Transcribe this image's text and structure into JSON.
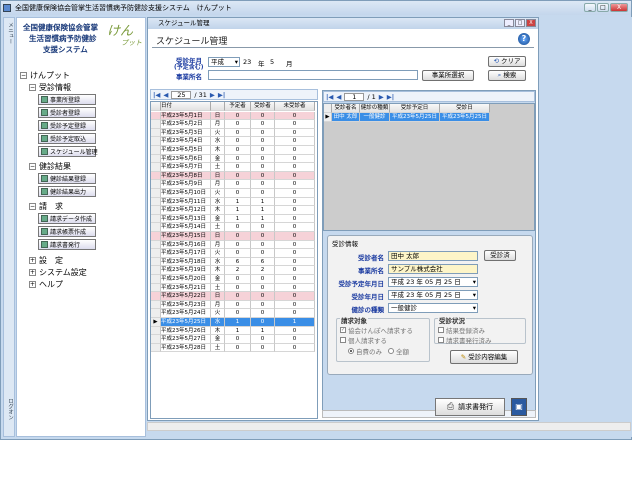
{
  "window": {
    "title": "全国健康保険協会管掌生活習慣病予防健診支援システム　けんプット",
    "minimize": "_",
    "maximize": "□",
    "close": "X"
  },
  "left_strip": {
    "top_label": "メニュー",
    "bottom_label": "ログオン"
  },
  "logo": {
    "line1": "全国健康保険協会管掌",
    "line2": "生活習慣病予防健診",
    "line3": "支援システム",
    "brand": "けん",
    "brand2": "プット"
  },
  "nav": {
    "root": "けんプット",
    "root_expander": "−",
    "groups": [
      {
        "label": "受診情報",
        "expander": "−"
      },
      {
        "label": "健診結果",
        "expander": "−"
      },
      {
        "label": "請　求",
        "expander": "−"
      },
      {
        "label": "設　定",
        "expander": "+"
      },
      {
        "label": "システム設定",
        "expander": "+"
      },
      {
        "label": "ヘルプ",
        "expander": "+"
      }
    ],
    "buttons": [
      "事業所登録",
      "受診者登録",
      "受診予定登録",
      "受診予定取込",
      "スケジュール管理",
      "健診結果登録",
      "健診結果出力",
      "請求データ作成",
      "請求帳票作成",
      "請求書発行"
    ]
  },
  "subwindow": {
    "title": "スケジュール管理",
    "heading": "スケジュール管理",
    "help": "?",
    "form": {
      "date_label_l1": "受診年月",
      "date_label_l2": "(予定含む)",
      "era": "平成",
      "year": "23",
      "year_unit": "年",
      "month": "5",
      "month_unit": "月",
      "company_label": "事業所名",
      "company_value": "",
      "company_select_btn": "事業所選択",
      "clear_btn": "クリア",
      "search_btn": "検索"
    },
    "left_pager": {
      "first": "|◀",
      "prev": "◀",
      "current": "25",
      "total": "/ 31",
      "next": "▶",
      "last": "▶|"
    },
    "right_pager": {
      "first": "|◀",
      "prev": "◀",
      "current": "1",
      "total": "/ 1",
      "next": "▶",
      "last": "▶|"
    },
    "calendar_headers": [
      "日付",
      "",
      "予定者",
      "受診者",
      "未受診者"
    ],
    "calendar_rows": [
      [
        "平成23年5月1日",
        "日",
        "0",
        "0",
        "0"
      ],
      [
        "平成23年5月2日",
        "月",
        "0",
        "0",
        "0"
      ],
      [
        "平成23年5月3日",
        "火",
        "0",
        "0",
        "0"
      ],
      [
        "平成23年5月4日",
        "水",
        "0",
        "0",
        "0"
      ],
      [
        "平成23年5月5日",
        "木",
        "0",
        "0",
        "0"
      ],
      [
        "平成23年5月6日",
        "金",
        "0",
        "0",
        "0"
      ],
      [
        "平成23年5月7日",
        "土",
        "0",
        "0",
        "0"
      ],
      [
        "平成23年5月8日",
        "日",
        "0",
        "0",
        "0"
      ],
      [
        "平成23年5月9日",
        "月",
        "0",
        "0",
        "0"
      ],
      [
        "平成23年5月10日",
        "火",
        "0",
        "0",
        "0"
      ],
      [
        "平成23年5月11日",
        "水",
        "1",
        "1",
        "0"
      ],
      [
        "平成23年5月12日",
        "木",
        "1",
        "1",
        "0"
      ],
      [
        "平成23年5月13日",
        "金",
        "1",
        "1",
        "0"
      ],
      [
        "平成23年5月14日",
        "土",
        "0",
        "0",
        "0"
      ],
      [
        "平成23年5月15日",
        "日",
        "0",
        "0",
        "0"
      ],
      [
        "平成23年5月16日",
        "月",
        "0",
        "0",
        "0"
      ],
      [
        "平成23年5月17日",
        "火",
        "0",
        "0",
        "0"
      ],
      [
        "平成23年5月18日",
        "水",
        "6",
        "6",
        "0"
      ],
      [
        "平成23年5月19日",
        "木",
        "2",
        "2",
        "0"
      ],
      [
        "平成23年5月20日",
        "金",
        "0",
        "0",
        "0"
      ],
      [
        "平成23年5月21日",
        "土",
        "0",
        "0",
        "0"
      ],
      [
        "平成23年5月22日",
        "日",
        "0",
        "0",
        "0"
      ],
      [
        "平成23年5月23日",
        "月",
        "0",
        "0",
        "0"
      ],
      [
        "平成23年5月24日",
        "火",
        "0",
        "0",
        "0"
      ],
      [
        "平成23年5月25日",
        "水",
        "1",
        "0",
        "1"
      ],
      [
        "平成23年5月26日",
        "木",
        "1",
        "1",
        "0"
      ],
      [
        "平成23年5月27日",
        "金",
        "0",
        "0",
        "0"
      ],
      [
        "平成23年5月28日",
        "土",
        "0",
        "0",
        "0"
      ]
    ],
    "pink_rows": [
      0,
      7,
      14,
      21
    ],
    "selected_row": 24,
    "schedule_headers": [
      "受診者名",
      "健診の種類",
      "受診予定日",
      "受診日"
    ],
    "schedule_rows": [
      [
        "田中 太郎",
        "一般健診",
        "平成23年5月25日",
        "平成23年5月25日"
      ]
    ],
    "detail": {
      "group_title": "受診情報",
      "name_label": "受診者名",
      "name_value": "田中 太郎",
      "company_label": "事業所名",
      "company_value": "サンプル株式会社",
      "planned_label": "受診予定年月日",
      "planned_value": "平成 23 年 05 月 25 日",
      "date_label": "受診年月日",
      "date_value": "平成 23 年 05 月 25 日",
      "type_label": "健診の種類",
      "type_value": "一般健診",
      "exam_done_btn": "受診済",
      "billing_title": "請求対象",
      "opt_association": "協会けんぽへ請求する",
      "opt_personal": "個人請求する",
      "radio_self": "自費のみ",
      "radio_all": "全額",
      "status_title": "受診状況",
      "status_result": "結果登録済み",
      "status_invoice": "請求書発行済み",
      "edit_btn": "受診内容編集"
    },
    "invoice_btn": "請求書発行"
  },
  "colors": {
    "window_bg": "#c6d9ee",
    "holiday_row": "#f6d2d8",
    "selected_row": "#3a8ee6",
    "label_blue": "#1a3aa0",
    "highlight_input": "#fdf5c8"
  }
}
